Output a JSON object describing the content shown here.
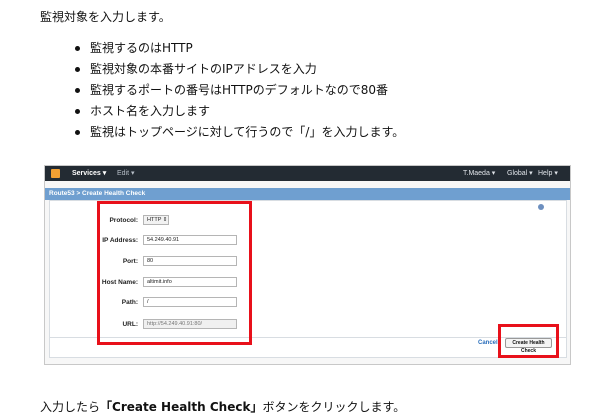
{
  "intro": "監視対象を入力します。",
  "bullets": [
    "監視するのはHTTP",
    "監視対象の本番サイトのIPアドレスを入力",
    "監視するポートの番号はHTTPのデフォルトなので80番",
    "ホスト名を入力します",
    "監視はトップページに対して行うので「/」を入力します。"
  ],
  "screenshot": {
    "topbar": {
      "services": "Services ▾",
      "edit": "Edit ▾",
      "user": "T.Maeda ▾",
      "region": "Global ▾",
      "help": "Help ▾"
    },
    "breadcrumb": "Route53 > Create Health Check",
    "form": {
      "protocol_label": "Protocol:",
      "protocol_value": "HTTP ⇕",
      "ip_label": "IP Address:",
      "ip_value": "54.249.40.91",
      "port_label": "Port:",
      "port_value": "80",
      "host_label": "Host Name:",
      "host_value": "altimit.info",
      "path_label": "Path:",
      "path_value": "/",
      "url_label": "URL:",
      "url_value": "http://54.249.40.91:80/"
    },
    "cancel": "Cancel",
    "create_button": "Create Health Check"
  },
  "closing": {
    "before": "入力したら",
    "button_name": "「Create Health Check」",
    "after": "ボタンをクリックします。"
  },
  "colors": {
    "highlight": "#e8101a",
    "topbar": "#232b33",
    "breadcrumb": "#6f9fd0",
    "link": "#2a6ebb"
  }
}
